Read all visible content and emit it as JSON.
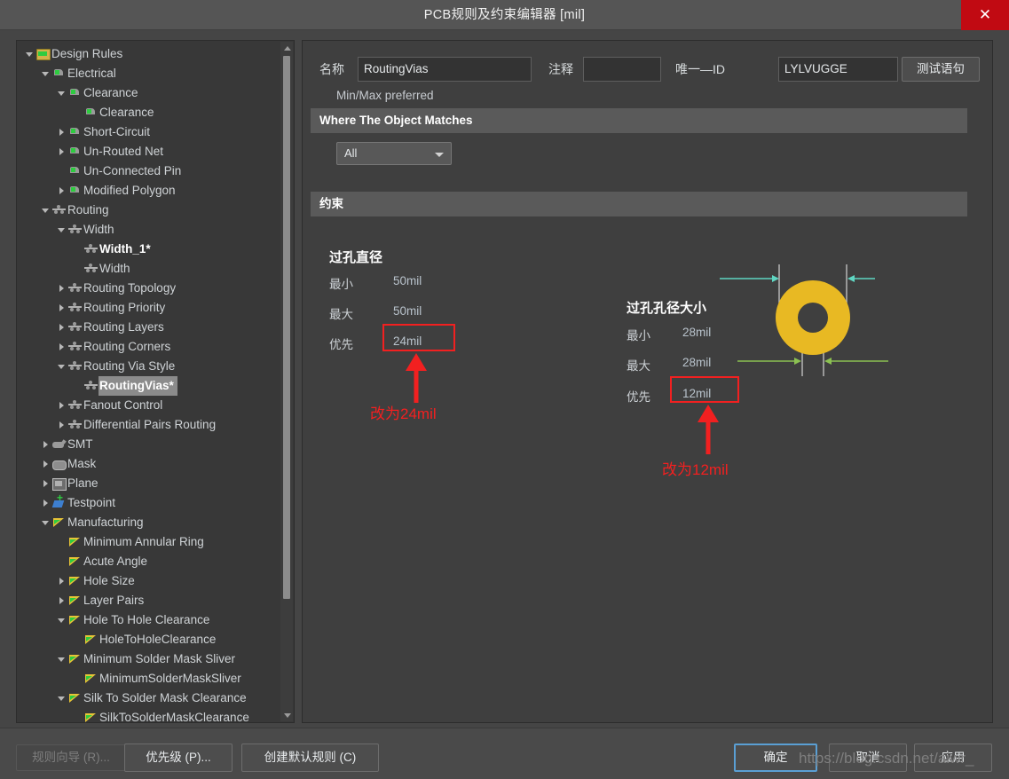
{
  "window": {
    "title": "PCB规则及约束编辑器 [mil]",
    "close_label": "✕",
    "close_icon": "close-icon"
  },
  "tree": {
    "items": [
      {
        "label": "Design Rules",
        "depth": 0,
        "arrow": "open",
        "icon": "folder-icon",
        "state": "normal"
      },
      {
        "label": "Electrical",
        "depth": 1,
        "arrow": "open",
        "icon": "electrical-icon",
        "state": "normal"
      },
      {
        "label": "Clearance",
        "depth": 2,
        "arrow": "open",
        "icon": "electrical-icon",
        "state": "normal"
      },
      {
        "label": "Clearance",
        "depth": 3,
        "arrow": "none",
        "icon": "electrical-icon",
        "state": "normal"
      },
      {
        "label": "Short-Circuit",
        "depth": 2,
        "arrow": "closed",
        "icon": "electrical-icon",
        "state": "normal"
      },
      {
        "label": "Un-Routed Net",
        "depth": 2,
        "arrow": "closed",
        "icon": "electrical-icon",
        "state": "normal"
      },
      {
        "label": "Un-Connected Pin",
        "depth": 2,
        "arrow": "none",
        "icon": "electrical-icon",
        "state": "normal"
      },
      {
        "label": "Modified Polygon",
        "depth": 2,
        "arrow": "closed",
        "icon": "electrical-icon",
        "state": "normal"
      },
      {
        "label": "Routing",
        "depth": 1,
        "arrow": "open",
        "icon": "routing-icon",
        "state": "normal"
      },
      {
        "label": "Width",
        "depth": 2,
        "arrow": "open",
        "icon": "routing-icon",
        "state": "normal"
      },
      {
        "label": "Width_1*",
        "depth": 3,
        "arrow": "none",
        "icon": "routing-icon",
        "state": "bold"
      },
      {
        "label": "Width",
        "depth": 3,
        "arrow": "none",
        "icon": "routing-icon",
        "state": "normal"
      },
      {
        "label": "Routing Topology",
        "depth": 2,
        "arrow": "closed",
        "icon": "routing-icon",
        "state": "normal"
      },
      {
        "label": "Routing Priority",
        "depth": 2,
        "arrow": "closed",
        "icon": "routing-icon",
        "state": "normal"
      },
      {
        "label": "Routing Layers",
        "depth": 2,
        "arrow": "closed",
        "icon": "routing-icon",
        "state": "normal"
      },
      {
        "label": "Routing Corners",
        "depth": 2,
        "arrow": "closed",
        "icon": "routing-icon",
        "state": "normal"
      },
      {
        "label": "Routing Via Style",
        "depth": 2,
        "arrow": "open",
        "icon": "routing-icon",
        "state": "normal"
      },
      {
        "label": "RoutingVias*",
        "depth": 3,
        "arrow": "none",
        "icon": "routing-icon",
        "state": "selected"
      },
      {
        "label": "Fanout Control",
        "depth": 2,
        "arrow": "closed",
        "icon": "routing-icon",
        "state": "normal"
      },
      {
        "label": "Differential Pairs Routing",
        "depth": 2,
        "arrow": "closed",
        "icon": "routing-icon",
        "state": "normal"
      },
      {
        "label": "SMT",
        "depth": 1,
        "arrow": "closed",
        "icon": "smt-icon",
        "state": "normal"
      },
      {
        "label": "Mask",
        "depth": 1,
        "arrow": "closed",
        "icon": "mask-icon",
        "state": "normal"
      },
      {
        "label": "Plane",
        "depth": 1,
        "arrow": "closed",
        "icon": "plane-icon",
        "state": "normal"
      },
      {
        "label": "Testpoint",
        "depth": 1,
        "arrow": "closed",
        "icon": "testpoint-icon",
        "state": "normal"
      },
      {
        "label": "Manufacturing",
        "depth": 1,
        "arrow": "open",
        "icon": "manufacturing-icon",
        "state": "normal"
      },
      {
        "label": "Minimum Annular Ring",
        "depth": 2,
        "arrow": "none",
        "icon": "manufacturing-icon",
        "state": "normal"
      },
      {
        "label": "Acute Angle",
        "depth": 2,
        "arrow": "none",
        "icon": "manufacturing-icon",
        "state": "normal"
      },
      {
        "label": "Hole Size",
        "depth": 2,
        "arrow": "closed",
        "icon": "manufacturing-icon",
        "state": "normal"
      },
      {
        "label": "Layer Pairs",
        "depth": 2,
        "arrow": "closed",
        "icon": "manufacturing-icon",
        "state": "normal"
      },
      {
        "label": "Hole To Hole Clearance",
        "depth": 2,
        "arrow": "open",
        "icon": "manufacturing-icon",
        "state": "normal"
      },
      {
        "label": "HoleToHoleClearance",
        "depth": 3,
        "arrow": "none",
        "icon": "manufacturing-icon",
        "state": "normal"
      },
      {
        "label": "Minimum Solder Mask Sliver",
        "depth": 2,
        "arrow": "open",
        "icon": "manufacturing-icon",
        "state": "normal"
      },
      {
        "label": "MinimumSolderMaskSliver",
        "depth": 3,
        "arrow": "none",
        "icon": "manufacturing-icon",
        "state": "normal"
      },
      {
        "label": "Silk To Solder Mask Clearance",
        "depth": 2,
        "arrow": "open",
        "icon": "manufacturing-icon",
        "state": "normal"
      },
      {
        "label": "SilkToSolderMaskClearance",
        "depth": 3,
        "arrow": "none",
        "icon": "manufacturing-icon",
        "state": "normal"
      }
    ]
  },
  "form": {
    "name_label": "名称",
    "name_value": "RoutingVias",
    "comment_label": "注释",
    "comment_value": "",
    "uniqueid_label": "唯一—ID",
    "uniqueid_value": "LYLVUGGE",
    "test_button": "测试语句"
  },
  "matches": {
    "header": "Where The Object Matches",
    "scope_value": "All"
  },
  "constraints": {
    "header": "约束",
    "minmax_label": "Min/Max preferred",
    "diameter": {
      "title": "过孔直径",
      "min_label": "最小",
      "min_value": "50mil",
      "max_label": "最大",
      "max_value": "50mil",
      "pref_label": "优先",
      "pref_value": "24mil"
    },
    "hole": {
      "title": "过孔孔径大小",
      "min_label": "最小",
      "min_value": "28mil",
      "max_label": "最大",
      "max_value": "28mil",
      "pref_label": "优先",
      "pref_value": "12mil"
    }
  },
  "annotations": {
    "diameter_note": "改为24mil",
    "hole_note": "改为12mil"
  },
  "footer": {
    "wizard_button": "规则向导 (R)...",
    "priority_button": "优先级 (P)...",
    "default_rules_button": "创建默认规则 (C)",
    "ok_button": "确定",
    "cancel_button": "取消",
    "apply_button": "应用",
    "watermark": "https://blog.csdn.net/aiwr_"
  },
  "colors": {
    "accent_red": "#f22020",
    "via_gold": "#e8b923",
    "arrow_cyan": "#5fd6c2",
    "arrow_green": "#8cc152",
    "close_red": "#c10a12",
    "selection_gray": "#8b8b8b"
  }
}
